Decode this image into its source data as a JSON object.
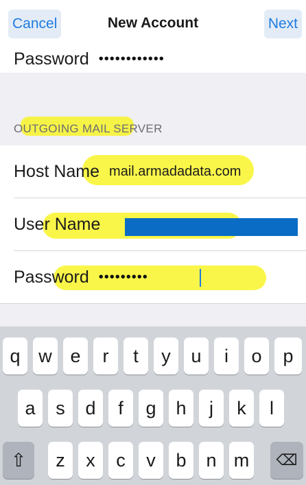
{
  "navbar": {
    "cancel_label": "Cancel",
    "title": "New Account",
    "next_label": "Next"
  },
  "incoming": {
    "password_label": "Password",
    "password_value": "••••••••••••"
  },
  "outgoing": {
    "section_header": "OUTGOING MAIL SERVER",
    "host_label": "Host Name",
    "host_value": "mail.armadadata.com",
    "user_label": "User Name",
    "password_label": "Password",
    "password_value": "•••••••••"
  },
  "keyboard": {
    "row1": [
      "q",
      "w",
      "e",
      "r",
      "t",
      "y",
      "u",
      "i",
      "o",
      "p"
    ],
    "row2": [
      "a",
      "s",
      "d",
      "f",
      "g",
      "h",
      "j",
      "k",
      "l"
    ],
    "row3": [
      "z",
      "x",
      "c",
      "v",
      "b",
      "n",
      "m"
    ],
    "shift_icon": "⇧",
    "delete_icon": "⌫"
  },
  "colors": {
    "accent": "#1f7be0",
    "highlight": "#f7f41b",
    "redaction": "#0a6cc4"
  }
}
